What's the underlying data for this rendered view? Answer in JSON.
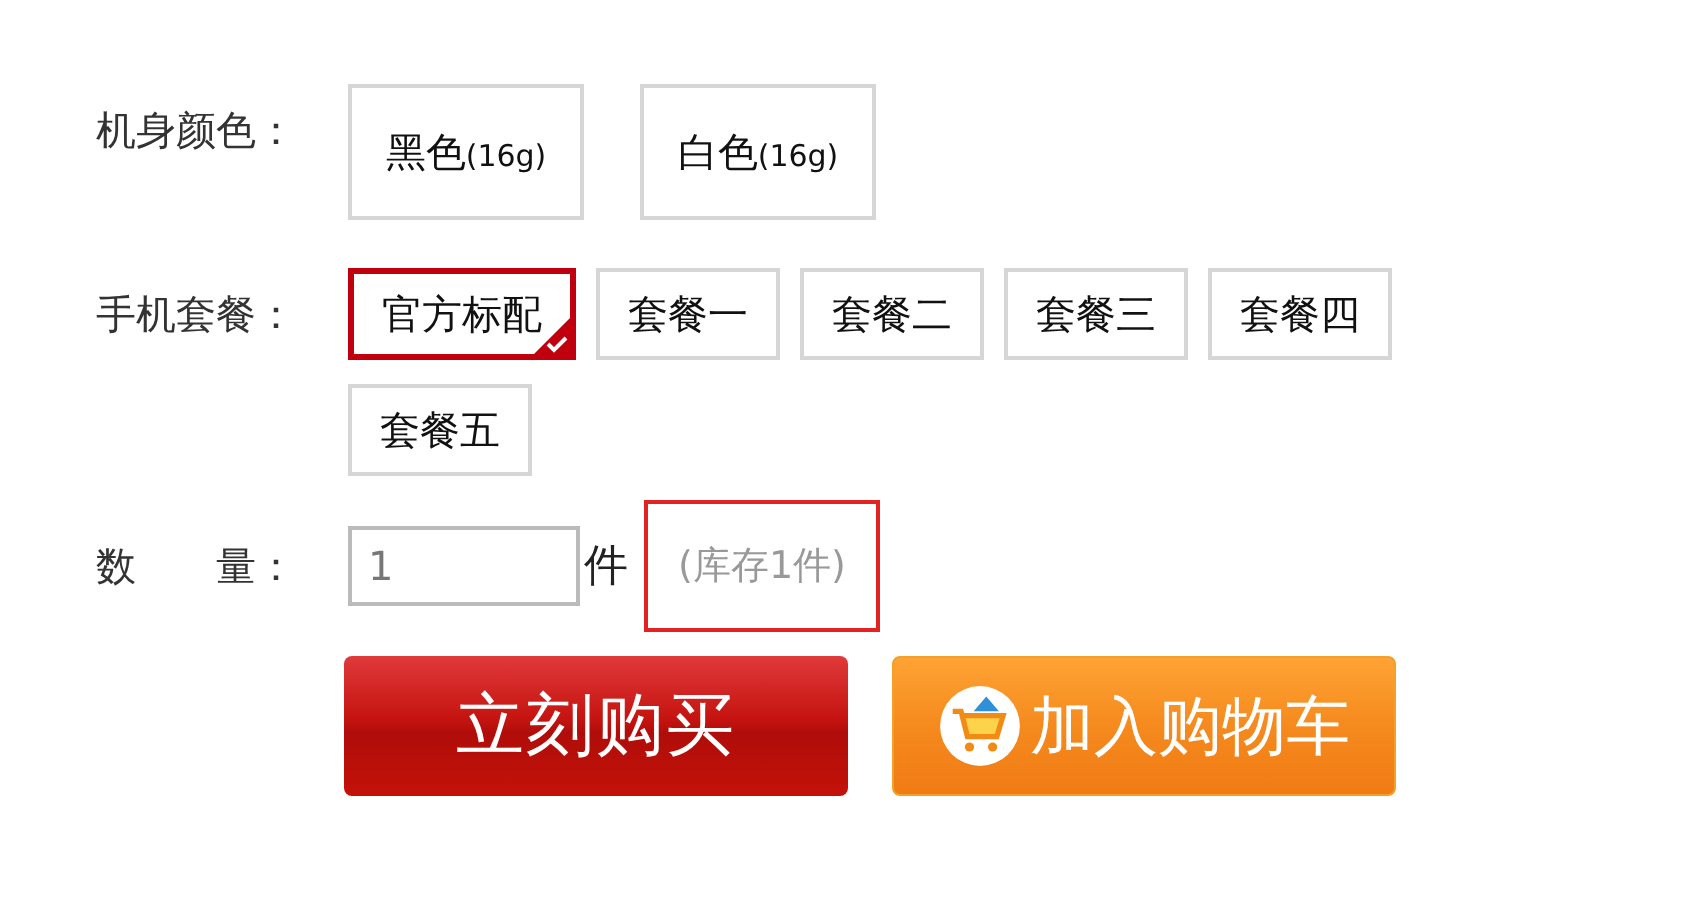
{
  "color_option": {
    "label": "机身颜色：",
    "options": [
      {
        "label": "黑色",
        "note": "(16g)",
        "selected": false
      },
      {
        "label": "白色",
        "note": "(16g)",
        "selected": false
      }
    ]
  },
  "package_option": {
    "label": "手机套餐：",
    "options": [
      {
        "label": "官方标配",
        "selected": true
      },
      {
        "label": "套餐一",
        "selected": false
      },
      {
        "label": "套餐二",
        "selected": false
      },
      {
        "label": "套餐三",
        "selected": false
      },
      {
        "label": "套餐四",
        "selected": false
      },
      {
        "label": "套餐五",
        "selected": false
      }
    ]
  },
  "quantity": {
    "label_parts": [
      "数",
      "量："
    ],
    "value": "1",
    "unit": "件",
    "stock": "(库存1件)"
  },
  "buttons": [
    {
      "kind": "buy",
      "label": "立刻购买"
    },
    {
      "kind": "cart",
      "label": "加入购物车"
    }
  ]
}
